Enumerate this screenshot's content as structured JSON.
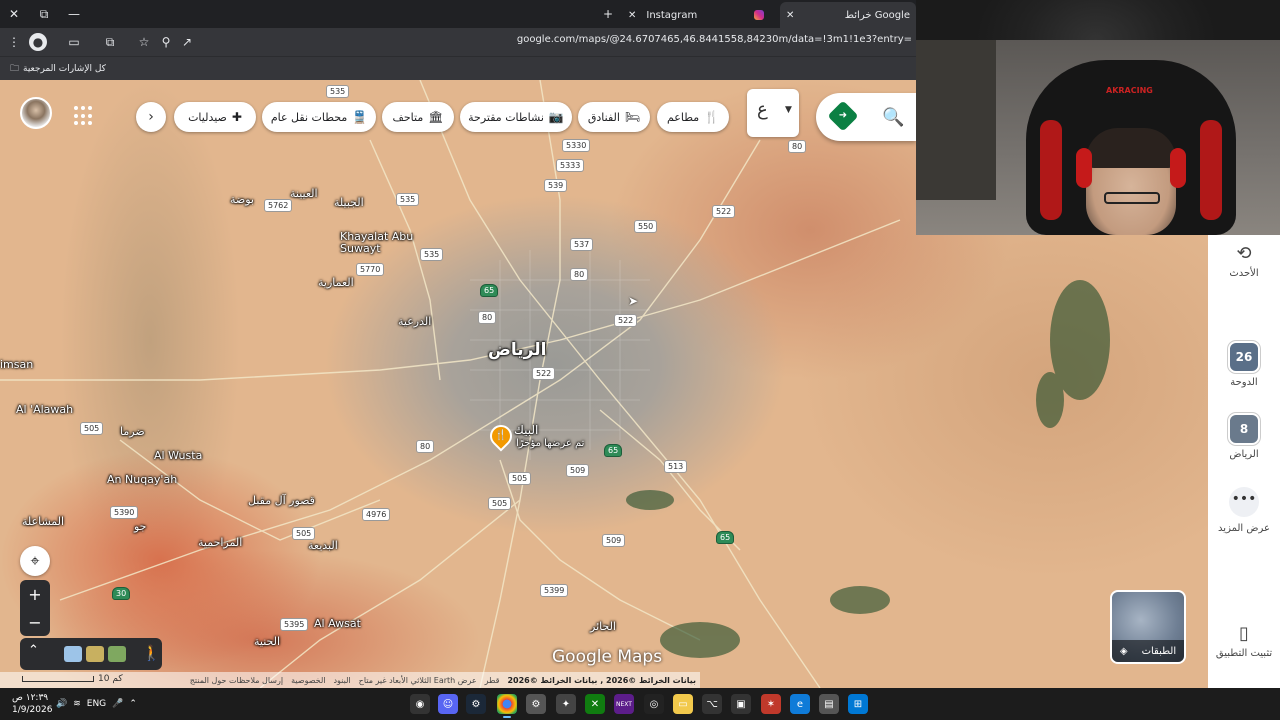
{
  "browser": {
    "tabs": [
      {
        "title": "خرائط Google",
        "active": true
      },
      {
        "title": "Instagram",
        "active": false
      }
    ],
    "url": "google.com/maps/@24.6707465,46.8441558,84230m/data=!3m1!1e3?entry=",
    "bookmarks_label": "كل الإشارات المرجعية",
    "icons": [
      "close-icon",
      "new-tab-icon",
      "minimize-icon",
      "restore-icon",
      "window-close-icon",
      "menu-icon",
      "extensions-icon",
      "cast-icon",
      "share-icon",
      "bookmark-star-icon",
      "search-lens-icon",
      "history-icon",
      "folder-icon"
    ]
  },
  "search": {
    "language_label": "ع",
    "icons": [
      "search-icon",
      "directions-icon",
      "caret-down-icon"
    ]
  },
  "chips": [
    {
      "label": "مطاعم",
      "icon": "🍴"
    },
    {
      "label": "الفنادق",
      "icon": "🛏"
    },
    {
      "label": "نشاطات مقترحة",
      "icon": "📷"
    },
    {
      "label": "متاحف",
      "icon": "🏛"
    },
    {
      "label": "محطات نقل عام",
      "icon": "🚆"
    },
    {
      "label": "صيدليات",
      "icon": "✚"
    }
  ],
  "chips_more": "›",
  "map": {
    "places": [
      {
        "name": "الرياض",
        "big": true
      },
      {
        "name": "Khayalat Abu Suwayt"
      },
      {
        "name": "الجبيلة"
      },
      {
        "name": "العيينة"
      },
      {
        "name": "بوضة"
      },
      {
        "name": "العمارية"
      },
      {
        "name": "الدرعية"
      },
      {
        "name": "Al 'Alawah"
      },
      {
        "name": "Al Wusta"
      },
      {
        "name": "An Nuqay'ah"
      },
      {
        "name": "قصور آل مقبل"
      },
      {
        "name": "المزاحمية"
      },
      {
        "name": "البديعة"
      },
      {
        "name": "Al Awsat"
      },
      {
        "name": "الحنية"
      },
      {
        "name": "المشاعلة"
      },
      {
        "name": "ضرما"
      },
      {
        "name": "جو"
      },
      {
        "name": "imsan"
      },
      {
        "name": "الحائر"
      },
      {
        "name": "البيك"
      },
      {
        "name": "تم عرضها مؤخرًا"
      }
    ],
    "road_shields": [
      {
        "num": "535",
        "green": false
      },
      {
        "num": "5330",
        "green": false
      },
      {
        "num": "5333",
        "green": false
      },
      {
        "num": "539",
        "green": false
      },
      {
        "num": "5762",
        "green": false
      },
      {
        "num": "535",
        "green": false
      },
      {
        "num": "550",
        "green": false
      },
      {
        "num": "522",
        "green": false
      },
      {
        "num": "80",
        "green": false
      },
      {
        "num": "537",
        "green": false
      },
      {
        "num": "535",
        "green": false
      },
      {
        "num": "5770",
        "green": false
      },
      {
        "num": "65",
        "green": true
      },
      {
        "num": "80",
        "green": false
      },
      {
        "num": "80",
        "green": false
      },
      {
        "num": "522",
        "green": false
      },
      {
        "num": "522",
        "green": false
      },
      {
        "num": "505",
        "green": false
      },
      {
        "num": "80",
        "green": false
      },
      {
        "num": "65",
        "green": true
      },
      {
        "num": "513",
        "green": false
      },
      {
        "num": "509",
        "green": false
      },
      {
        "num": "505",
        "green": false
      },
      {
        "num": "505",
        "green": false
      },
      {
        "num": "4976",
        "green": false
      },
      {
        "num": "5390",
        "green": false
      },
      {
        "num": "505",
        "green": false
      },
      {
        "num": "509",
        "green": false
      },
      {
        "num": "65",
        "green": true
      },
      {
        "num": "30",
        "green": true
      },
      {
        "num": "5399",
        "green": false
      },
      {
        "num": "5395",
        "green": false
      }
    ],
    "logo": "Google Maps",
    "attribution": {
      "data_label": "بيانات الخرائط ©2026 , بيانات الخرائط ©2026",
      "links": [
        "قطر",
        "عرض Earth الثلاثي الأبعاد غير متاح",
        "البنود",
        "الخصوصية",
        "إرسال ملاحظات حول المنتج"
      ]
    },
    "scale_label": "10 كم",
    "icons": [
      "poi-restaurant-icon",
      "cursor-icon"
    ]
  },
  "controls": {
    "zoom_in": "+",
    "zoom_out": "−",
    "locate_icon": "⌖",
    "expand_icon": "⌃",
    "pegman_icon": "🚶"
  },
  "layers": {
    "label": "الطبقات",
    "icon": "layers-icon"
  },
  "rail": [
    {
      "label": "الأحدث",
      "icon": "history-icon"
    },
    {
      "label": "الدوحة",
      "badge": "26",
      "color": "#5a6f88"
    },
    {
      "label": "الرياض",
      "badge": "8",
      "color": "#6a7a8c"
    },
    {
      "label": "عرض المزيد",
      "icon": "more-dots-icon"
    },
    {
      "label": "تثبيت التطبيق",
      "icon": "install-app-icon"
    }
  ],
  "webcam": {
    "brand": "AKRACING"
  },
  "taskbar": {
    "time": "١٢:٣٩ ص",
    "date": "1/9/2026",
    "language": "ENG",
    "apps": [
      "obs-icon",
      "discord-icon",
      "steam-icon",
      "chrome-icon",
      "settings-icon",
      "tool-icon",
      "xbox-icon",
      "next-icon",
      "opera-icon",
      "files-icon",
      "network-icon",
      "terminal-icon",
      "app-icon",
      "edge-icon",
      "snip-icon",
      "windows-icon"
    ]
  }
}
